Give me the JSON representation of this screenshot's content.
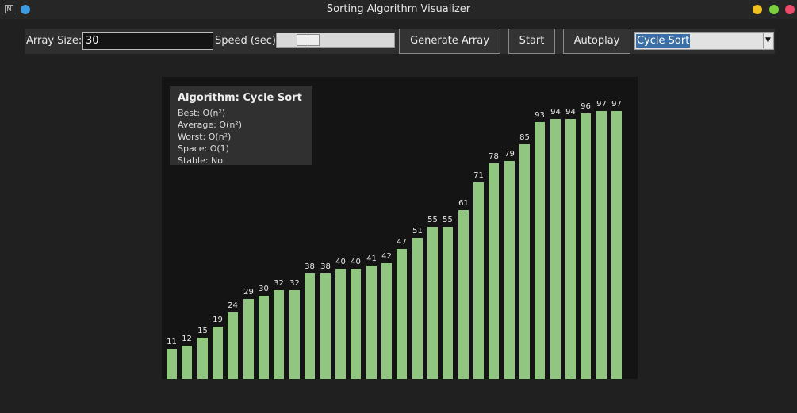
{
  "window": {
    "title": "Sorting Algorithm Visualizer",
    "app_icon_glyph": "N"
  },
  "toolbar": {
    "array_size_label": "Array Size:",
    "array_size_value": "30",
    "speed_label": "Speed (sec):",
    "speed_value": 0.25,
    "generate_label": "Generate Array",
    "start_label": "Start",
    "autoplay_label": "Autoplay",
    "algorithm_selected": "Cycle Sort"
  },
  "info": {
    "title": "Algorithm: Cycle Sort",
    "best": "Best: O(n²)",
    "average": "Average: O(n²)",
    "worst": "Worst: O(n²)",
    "space": "Space: O(1)",
    "stable": "Stable: No"
  },
  "bars": {
    "color": "#90c67f",
    "values": [
      11,
      12,
      15,
      19,
      24,
      29,
      30,
      32,
      32,
      38,
      38,
      40,
      40,
      41,
      42,
      47,
      51,
      55,
      55,
      61,
      71,
      78,
      79,
      85,
      93,
      94,
      94,
      96,
      97,
      97
    ]
  },
  "colors": {
    "window_bg": "#202020",
    "canvas_bg": "#141414",
    "info_bg": "#303030",
    "selection": "#3a6ea5"
  }
}
